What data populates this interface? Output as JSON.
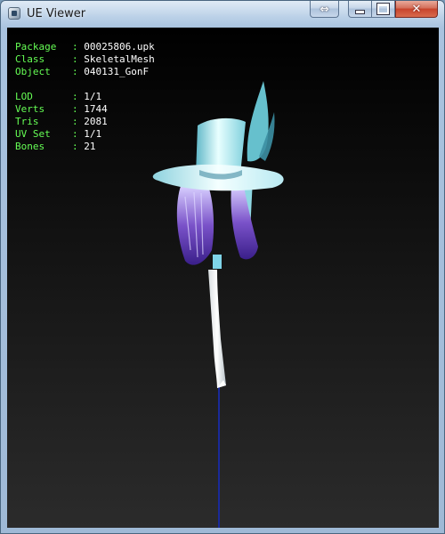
{
  "window": {
    "title": "UE Viewer",
    "buttons": {
      "fullscreen_glyph": "⇔",
      "close_glyph": "✕"
    }
  },
  "viewport": {
    "info": {
      "package": {
        "key": "Package",
        "value": "00025806.upk"
      },
      "class": {
        "key": "Class",
        "value": "SkeletalMesh"
      },
      "object": {
        "key": "Object",
        "value": "040131_GonF"
      },
      "lod": {
        "key": "LOD",
        "value": "1/1"
      },
      "verts": {
        "key": "Verts",
        "value": "1744"
      },
      "tris": {
        "key": "Tris",
        "value": "2081"
      },
      "uvset": {
        "key": "UV Set",
        "value": "1/1"
      },
      "bones": {
        "key": "Bones",
        "value": "21"
      }
    },
    "colors": {
      "label": "#66ff55",
      "value": "#ffffff",
      "hat": "#9fe6f0",
      "hair": "#7b55c8",
      "bone_axis": "#1a2a9a"
    }
  }
}
